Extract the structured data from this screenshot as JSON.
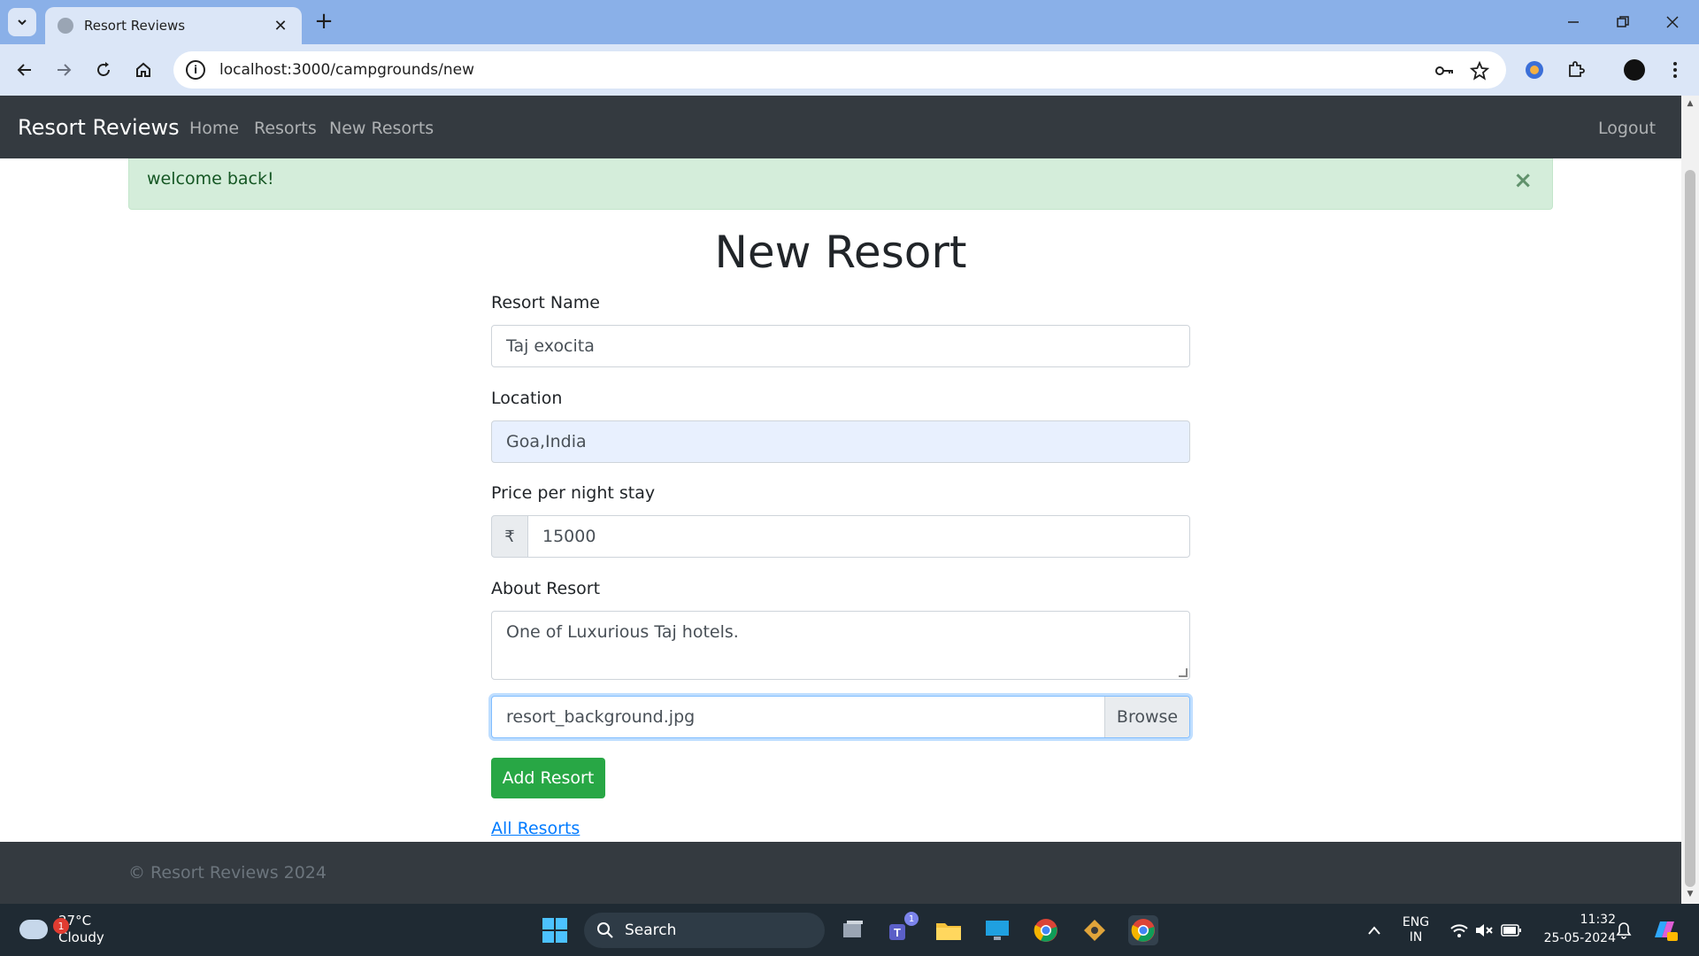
{
  "browser": {
    "tab_title": "Resort Reviews",
    "url": "localhost:3000/campgrounds/new",
    "new_tab_symbol": "+",
    "tab_close_symbol": "✕"
  },
  "navbar": {
    "brand": "Resort Reviews",
    "links": [
      "Home",
      "Resorts",
      "New Resorts"
    ],
    "logout": "Logout"
  },
  "alert": {
    "message": "welcome back!",
    "close_symbol": "×"
  },
  "form": {
    "title": "New Resort",
    "name_label": "Resort Name",
    "name_value": "Taj exocita",
    "location_label": "Location",
    "location_value": "Goa,India",
    "price_label": "Price per night stay",
    "currency_symbol": "₹",
    "price_value": "15000",
    "about_label": "About Resort",
    "about_value": "One of Luxurious Taj hotels.",
    "file_name": "resort_background.jpg",
    "browse_label": "Browse",
    "submit_label": "Add Resort",
    "all_link": "All Resorts"
  },
  "footer": {
    "copyright": "© Resort Reviews 2024"
  },
  "taskbar": {
    "temperature": "27°C",
    "condition": "Cloudy",
    "weather_badge": "1",
    "search_label": "Search",
    "teams_badge": "1",
    "lang_top": "ENG",
    "lang_bottom": "IN",
    "time": "11:32",
    "date": "25-05-2024"
  },
  "colors": {
    "navbar_bg": "#343a40",
    "alert_bg": "#d4edda",
    "success_button": "#28a745",
    "link": "#007bff",
    "browser_accent": "#8ab0e8"
  }
}
